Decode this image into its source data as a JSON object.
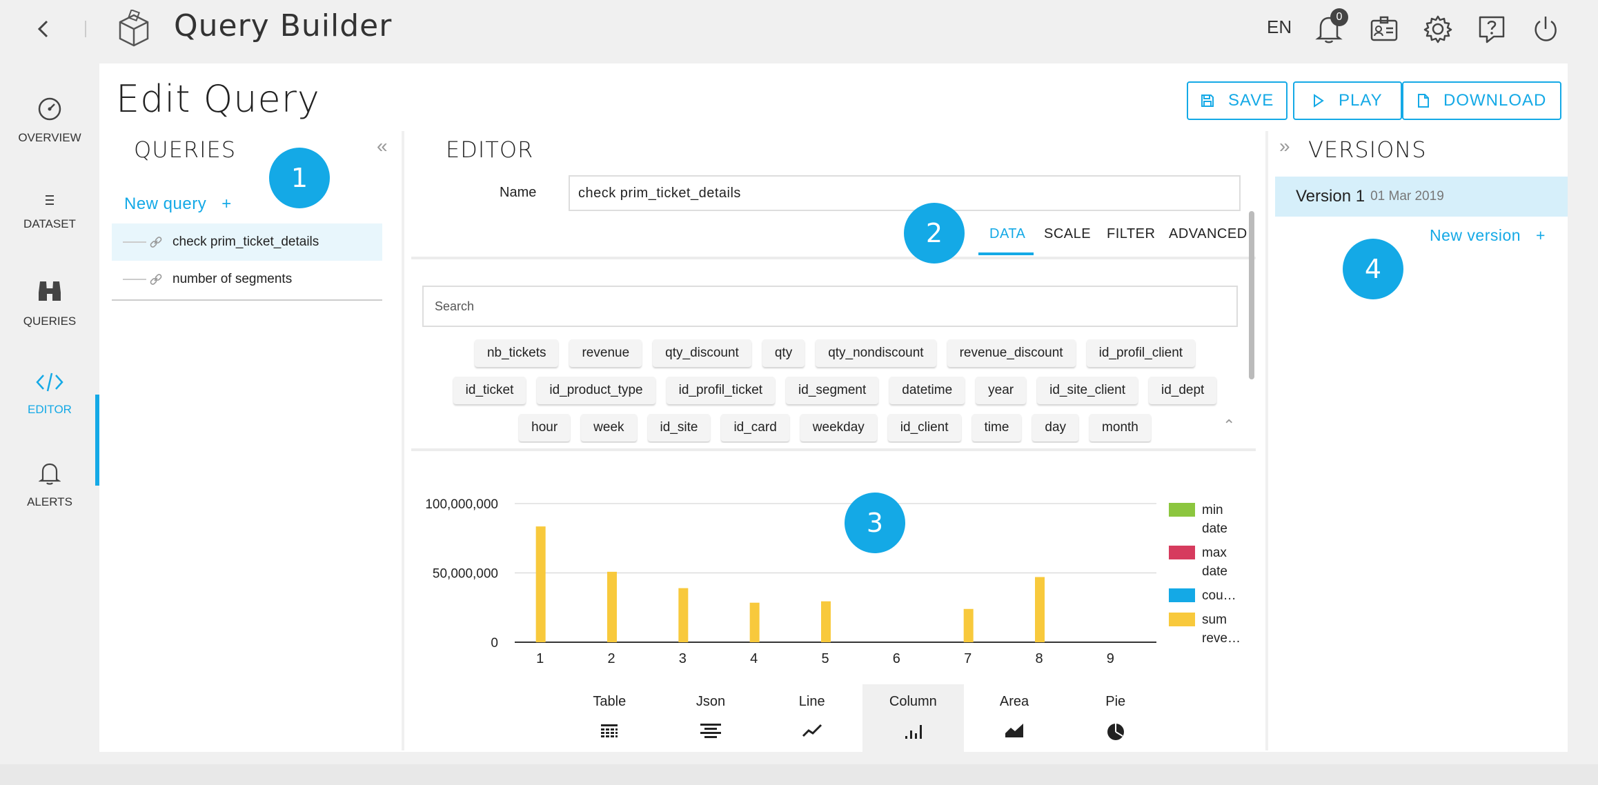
{
  "app": {
    "title": "Query Builder",
    "language": "EN",
    "notification_count": "0"
  },
  "sidebar": {
    "items": [
      {
        "label": "OVERVIEW",
        "icon": "gauge-icon"
      },
      {
        "label": "DATASET",
        "icon": "list-icon"
      },
      {
        "label": "QUERIES",
        "icon": "binoculars-icon"
      },
      {
        "label": "EDITOR",
        "icon": "code-icon",
        "active": true
      },
      {
        "label": "ALERTS",
        "icon": "bell-icon"
      }
    ],
    "collapse_symbol": "«"
  },
  "page": {
    "title": "Edit Query",
    "buttons": {
      "save": "SAVE",
      "play": "PLAY",
      "download": "DOWNLOAD"
    }
  },
  "queries": {
    "title": "QUERIES",
    "collapse_symbol": "«",
    "new_query": "New query",
    "new_query_plus": "+",
    "items": [
      "check prim_ticket_details",
      "number of segments"
    ]
  },
  "editor": {
    "title": "EDITOR",
    "name_label": "Name",
    "name_value": "check prim_ticket_details",
    "tabs": [
      "DATA",
      "SCALE",
      "FILTER",
      "ADVANCED"
    ],
    "search_placeholder": "Search",
    "chip_rows": [
      [
        "nb_tickets",
        "revenue",
        "qty_discount",
        "qty",
        "qty_nondiscount",
        "revenue_discount",
        "id_profil_client"
      ],
      [
        "id_ticket",
        "id_product_type",
        "id_profil_ticket",
        "id_segment",
        "datetime",
        "year",
        "id_site_client",
        "id_dept"
      ],
      [
        "hour",
        "week",
        "id_site",
        "id_card",
        "weekday",
        "id_client",
        "time",
        "day",
        "month"
      ]
    ],
    "chips_collapse_symbol": "⌃"
  },
  "chart_data": {
    "type": "bar",
    "categories": [
      "1",
      "2",
      "3",
      "4",
      "5",
      "6",
      "7",
      "8",
      "9"
    ],
    "series": [
      {
        "name": "min date",
        "color": "#8cc63f",
        "values": [
          0,
          0,
          0,
          0,
          0,
          0,
          0,
          0,
          0
        ]
      },
      {
        "name": "max date",
        "color": "#d63b5e",
        "values": [
          0,
          0,
          0,
          0,
          0,
          0,
          0,
          0,
          0
        ]
      },
      {
        "name": "cou…",
        "color": "#14a9e6",
        "values": [
          0,
          0,
          0,
          0,
          0,
          0,
          0,
          0,
          0
        ]
      },
      {
        "name": "sum reve…",
        "color": "#f8c93c",
        "values": [
          83500000,
          50800000,
          39000000,
          28500000,
          29500000,
          0,
          24000000,
          47000000,
          0
        ]
      }
    ],
    "yticks": [
      "100,000,000",
      "50,000,000",
      "0"
    ],
    "ylim": [
      0,
      100000000
    ],
    "grid": true,
    "legend_position": "right"
  },
  "viz_tabs": [
    {
      "label": "Table",
      "icon": "table-icon"
    },
    {
      "label": "Json",
      "icon": "json-icon"
    },
    {
      "label": "Line",
      "icon": "line-chart-icon"
    },
    {
      "label": "Column",
      "icon": "column-chart-icon",
      "active": true
    },
    {
      "label": "Area",
      "icon": "area-chart-icon"
    },
    {
      "label": "Pie",
      "icon": "pie-chart-icon"
    }
  ],
  "versions": {
    "title": "VERSIONS",
    "expand_symbol": "»",
    "items": [
      {
        "name": "Version 1",
        "date": "01 Mar 2019"
      }
    ],
    "new_version": "New version",
    "new_version_plus": "+"
  },
  "markers": [
    "1",
    "2",
    "3",
    "4"
  ],
  "colors": {
    "accent": "#14a9e6",
    "bar": "#f8c93c"
  }
}
